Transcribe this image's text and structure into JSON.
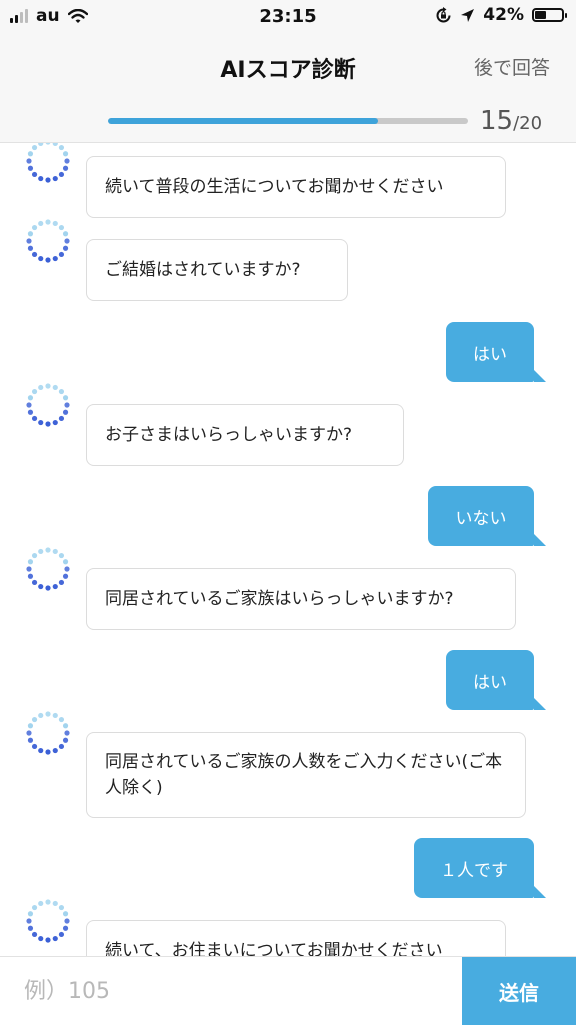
{
  "status_bar": {
    "carrier": "au",
    "time": "23:15",
    "battery_percent": "42%",
    "battery_level": 0.42,
    "icons": [
      "signal-icon",
      "wifi-icon",
      "rotation-lock-icon",
      "location-arrow-icon",
      "battery-icon"
    ]
  },
  "nav": {
    "title": "AIスコア診断",
    "later_label": "後で回答"
  },
  "progress": {
    "current": "15",
    "total": "/20",
    "fraction": 0.75
  },
  "messages": [
    {
      "from": "bot",
      "text": "続いて普段の生活についてお聞かせください"
    },
    {
      "from": "bot",
      "text": "ご結婚はされていますか?"
    },
    {
      "from": "user",
      "text": "はい"
    },
    {
      "from": "bot",
      "text": "お子さまはいらっしゃいますか?"
    },
    {
      "from": "user",
      "text": "いない"
    },
    {
      "from": "bot",
      "text": "同居されているご家族はいらっしゃいますか?"
    },
    {
      "from": "user",
      "text": "はい"
    },
    {
      "from": "bot",
      "text": "同居されているご家族の人数をご入力ください(ご本人除く)"
    },
    {
      "from": "user",
      "text": "１人です"
    },
    {
      "from": "bot",
      "text": "続いて、お住まいについてお聞かせください"
    }
  ],
  "input": {
    "placeholder": "例）105",
    "value": "",
    "send_label": "送信"
  },
  "colors": {
    "accent": "#48ace0",
    "progress": "#3ea3da",
    "avatar_dots_light": "#7fc4e8",
    "avatar_dots_dark": "#3a5fd6"
  }
}
